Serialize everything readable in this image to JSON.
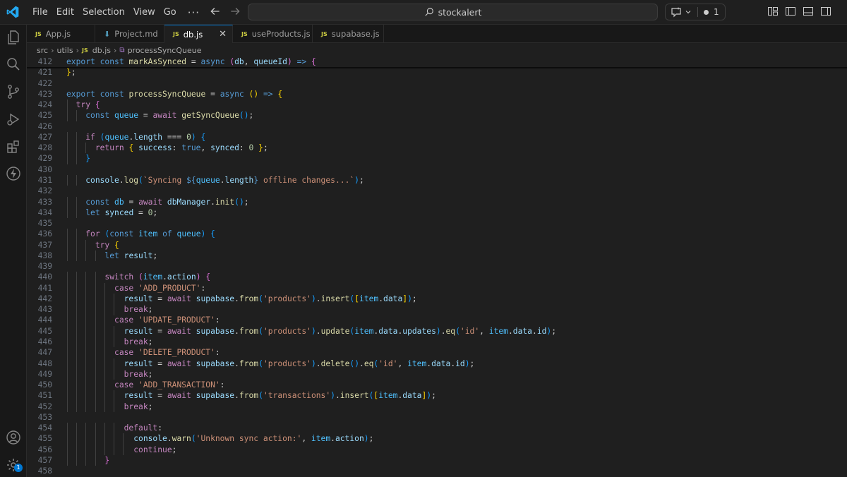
{
  "menu": {
    "file": "File",
    "edit": "Edit",
    "selection": "Selection",
    "view": "View",
    "go": "Go",
    "more": "···"
  },
  "search": {
    "text": "stockalert"
  },
  "copilot": {
    "count": "1"
  },
  "tabs": [
    {
      "icon": "JS",
      "label": "App.js"
    },
    {
      "icon": "md-icon",
      "label": "Project.md"
    },
    {
      "icon": "JS",
      "label": "db.js"
    },
    {
      "icon": "JS",
      "label": "useProducts.js"
    },
    {
      "icon": "JS",
      "label": "supabase.js"
    }
  ],
  "breadcrumb": {
    "p1": "src",
    "p2": "utils",
    "p3": "db.js",
    "p4": "processSyncQueue",
    "js": "JS"
  },
  "activity": {
    "settings_badge": "1"
  },
  "lines": [
    {
      "n": "412",
      "segs": [
        [
          "export",
          "kw"
        ],
        [
          " ",
          ""
        ],
        [
          "const",
          "kw"
        ],
        [
          " ",
          ""
        ],
        [
          "markAsSynced",
          "fn"
        ],
        [
          " = ",
          ""
        ],
        [
          "async",
          "kw"
        ],
        [
          " ",
          ""
        ],
        [
          "(",
          "br2"
        ],
        [
          "db",
          "var"
        ],
        [
          ", ",
          ""
        ],
        [
          "queueId",
          "var"
        ],
        [
          ")",
          "br2"
        ],
        [
          " ",
          ""
        ],
        [
          "=>",
          "kw"
        ],
        [
          " ",
          ""
        ],
        [
          "{",
          "br2"
        ]
      ]
    },
    {
      "n": "421",
      "segs": [
        [
          "}",
          "br1"
        ],
        [
          ";",
          ""
        ]
      ]
    },
    {
      "n": "422",
      "segs": []
    },
    {
      "n": "423",
      "segs": [
        [
          "export",
          "kw"
        ],
        [
          " ",
          ""
        ],
        [
          "const",
          "kw"
        ],
        [
          " ",
          ""
        ],
        [
          "processSyncQueue",
          "fn"
        ],
        [
          " = ",
          ""
        ],
        [
          "async",
          "kw"
        ],
        [
          " ",
          ""
        ],
        [
          "()",
          "br1"
        ],
        [
          " ",
          ""
        ],
        [
          "=>",
          "kw"
        ],
        [
          " ",
          ""
        ],
        [
          "{",
          "br1"
        ]
      ]
    },
    {
      "n": "424",
      "segs": [
        [
          "  ",
          ""
        ],
        [
          "try",
          "ctl"
        ],
        [
          " ",
          ""
        ],
        [
          "{",
          "br2"
        ]
      ]
    },
    {
      "n": "425",
      "segs": [
        [
          "    ",
          ""
        ],
        [
          "const",
          "kw"
        ],
        [
          " ",
          ""
        ],
        [
          "queue",
          "cst"
        ],
        [
          " = ",
          ""
        ],
        [
          "await",
          "ctl"
        ],
        [
          " ",
          ""
        ],
        [
          "getSyncQueue",
          "fn"
        ],
        [
          "()",
          "br3"
        ],
        [
          ";",
          ""
        ]
      ]
    },
    {
      "n": "426",
      "segs": []
    },
    {
      "n": "427",
      "segs": [
        [
          "    ",
          ""
        ],
        [
          "if",
          "ctl"
        ],
        [
          " ",
          ""
        ],
        [
          "(",
          "br3"
        ],
        [
          "queue",
          "cst"
        ],
        [
          ".",
          ""
        ],
        [
          "length",
          "var"
        ],
        [
          " === ",
          ""
        ],
        [
          "0",
          "num"
        ],
        [
          ")",
          "br3"
        ],
        [
          " ",
          ""
        ],
        [
          "{",
          "br3"
        ]
      ]
    },
    {
      "n": "428",
      "segs": [
        [
          "      ",
          ""
        ],
        [
          "return",
          "ctl"
        ],
        [
          " ",
          ""
        ],
        [
          "{",
          "br1"
        ],
        [
          " ",
          ""
        ],
        [
          "success",
          "var"
        ],
        [
          ": ",
          ""
        ],
        [
          "true",
          "bool"
        ],
        [
          ", ",
          ""
        ],
        [
          "synced",
          "var"
        ],
        [
          ": ",
          ""
        ],
        [
          "0",
          "num"
        ],
        [
          " ",
          ""
        ],
        [
          "}",
          "br1"
        ],
        [
          ";",
          ""
        ]
      ]
    },
    {
      "n": "429",
      "segs": [
        [
          "    ",
          ""
        ],
        [
          "}",
          "br3"
        ]
      ]
    },
    {
      "n": "430",
      "segs": []
    },
    {
      "n": "431",
      "segs": [
        [
          "    ",
          ""
        ],
        [
          "console",
          "var"
        ],
        [
          ".",
          ""
        ],
        [
          "log",
          "fn"
        ],
        [
          "(",
          "br3"
        ],
        [
          "`Syncing ",
          "str"
        ],
        [
          "${",
          "kw"
        ],
        [
          "queue",
          "cst"
        ],
        [
          ".",
          ""
        ],
        [
          "length",
          "var"
        ],
        [
          "}",
          "kw"
        ],
        [
          " offline changes...`",
          "str"
        ],
        [
          ")",
          "br3"
        ],
        [
          ";",
          ""
        ]
      ]
    },
    {
      "n": "432",
      "segs": []
    },
    {
      "n": "433",
      "segs": [
        [
          "    ",
          ""
        ],
        [
          "const",
          "kw"
        ],
        [
          " ",
          ""
        ],
        [
          "db",
          "cst"
        ],
        [
          " = ",
          ""
        ],
        [
          "await",
          "ctl"
        ],
        [
          " ",
          ""
        ],
        [
          "dbManager",
          "var"
        ],
        [
          ".",
          ""
        ],
        [
          "init",
          "fn"
        ],
        [
          "()",
          "br3"
        ],
        [
          ";",
          ""
        ]
      ]
    },
    {
      "n": "434",
      "segs": [
        [
          "    ",
          ""
        ],
        [
          "let",
          "kw"
        ],
        [
          " ",
          ""
        ],
        [
          "synced",
          "var"
        ],
        [
          " = ",
          ""
        ],
        [
          "0",
          "num"
        ],
        [
          ";",
          ""
        ]
      ]
    },
    {
      "n": "435",
      "segs": []
    },
    {
      "n": "436",
      "segs": [
        [
          "    ",
          ""
        ],
        [
          "for",
          "ctl"
        ],
        [
          " ",
          ""
        ],
        [
          "(",
          "br3"
        ],
        [
          "const",
          "kw"
        ],
        [
          " ",
          ""
        ],
        [
          "item",
          "cst"
        ],
        [
          " ",
          ""
        ],
        [
          "of",
          "kw"
        ],
        [
          " ",
          ""
        ],
        [
          "queue",
          "cst"
        ],
        [
          ")",
          "br3"
        ],
        [
          " ",
          ""
        ],
        [
          "{",
          "br3"
        ]
      ]
    },
    {
      "n": "437",
      "segs": [
        [
          "      ",
          ""
        ],
        [
          "try",
          "ctl"
        ],
        [
          " ",
          ""
        ],
        [
          "{",
          "br1"
        ]
      ]
    },
    {
      "n": "438",
      "segs": [
        [
          "        ",
          ""
        ],
        [
          "let",
          "kw"
        ],
        [
          " ",
          ""
        ],
        [
          "result",
          "var"
        ],
        [
          ";",
          ""
        ]
      ]
    },
    {
      "n": "439",
      "segs": []
    },
    {
      "n": "440",
      "segs": [
        [
          "        ",
          ""
        ],
        [
          "switch",
          "ctl"
        ],
        [
          " ",
          ""
        ],
        [
          "(",
          "br2"
        ],
        [
          "item",
          "cst"
        ],
        [
          ".",
          ""
        ],
        [
          "action",
          "var"
        ],
        [
          ")",
          "br2"
        ],
        [
          " ",
          ""
        ],
        [
          "{",
          "br2"
        ]
      ]
    },
    {
      "n": "441",
      "segs": [
        [
          "          ",
          ""
        ],
        [
          "case",
          "ctl"
        ],
        [
          " ",
          ""
        ],
        [
          "'ADD_PRODUCT'",
          "str"
        ],
        [
          ":",
          ""
        ]
      ]
    },
    {
      "n": "442",
      "segs": [
        [
          "            ",
          ""
        ],
        [
          "result",
          "var"
        ],
        [
          " = ",
          ""
        ],
        [
          "await",
          "ctl"
        ],
        [
          " ",
          ""
        ],
        [
          "supabase",
          "var"
        ],
        [
          ".",
          ""
        ],
        [
          "from",
          "fn"
        ],
        [
          "(",
          "br3"
        ],
        [
          "'products'",
          "str"
        ],
        [
          ")",
          "br3"
        ],
        [
          ".",
          ""
        ],
        [
          "insert",
          "fn"
        ],
        [
          "(",
          "br3"
        ],
        [
          "[",
          "br1"
        ],
        [
          "item",
          "cst"
        ],
        [
          ".",
          ""
        ],
        [
          "data",
          "var"
        ],
        [
          "]",
          "br1"
        ],
        [
          ")",
          "br3"
        ],
        [
          ";",
          ""
        ]
      ]
    },
    {
      "n": "443",
      "segs": [
        [
          "            ",
          ""
        ],
        [
          "break",
          "ctl"
        ],
        [
          ";",
          ""
        ]
      ]
    },
    {
      "n": "444",
      "segs": [
        [
          "          ",
          ""
        ],
        [
          "case",
          "ctl"
        ],
        [
          " ",
          ""
        ],
        [
          "'UPDATE_PRODUCT'",
          "str"
        ],
        [
          ":",
          ""
        ]
      ]
    },
    {
      "n": "445",
      "segs": [
        [
          "            ",
          ""
        ],
        [
          "result",
          "var"
        ],
        [
          " = ",
          ""
        ],
        [
          "await",
          "ctl"
        ],
        [
          " ",
          ""
        ],
        [
          "supabase",
          "var"
        ],
        [
          ".",
          ""
        ],
        [
          "from",
          "fn"
        ],
        [
          "(",
          "br3"
        ],
        [
          "'products'",
          "str"
        ],
        [
          ")",
          "br3"
        ],
        [
          ".",
          ""
        ],
        [
          "update",
          "fn"
        ],
        [
          "(",
          "br3"
        ],
        [
          "item",
          "cst"
        ],
        [
          ".",
          ""
        ],
        [
          "data",
          "var"
        ],
        [
          ".",
          ""
        ],
        [
          "updates",
          "var"
        ],
        [
          ")",
          "br3"
        ],
        [
          ".",
          ""
        ],
        [
          "eq",
          "fn"
        ],
        [
          "(",
          "br3"
        ],
        [
          "'id'",
          "str"
        ],
        [
          ", ",
          ""
        ],
        [
          "item",
          "cst"
        ],
        [
          ".",
          ""
        ],
        [
          "data",
          "var"
        ],
        [
          ".",
          ""
        ],
        [
          "id",
          "var"
        ],
        [
          ")",
          "br3"
        ],
        [
          ";",
          ""
        ]
      ]
    },
    {
      "n": "446",
      "segs": [
        [
          "            ",
          ""
        ],
        [
          "break",
          "ctl"
        ],
        [
          ";",
          ""
        ]
      ]
    },
    {
      "n": "447",
      "segs": [
        [
          "          ",
          ""
        ],
        [
          "case",
          "ctl"
        ],
        [
          " ",
          ""
        ],
        [
          "'DELETE_PRODUCT'",
          "str"
        ],
        [
          ":",
          ""
        ]
      ]
    },
    {
      "n": "448",
      "segs": [
        [
          "            ",
          ""
        ],
        [
          "result",
          "var"
        ],
        [
          " = ",
          ""
        ],
        [
          "await",
          "ctl"
        ],
        [
          " ",
          ""
        ],
        [
          "supabase",
          "var"
        ],
        [
          ".",
          ""
        ],
        [
          "from",
          "fn"
        ],
        [
          "(",
          "br3"
        ],
        [
          "'products'",
          "str"
        ],
        [
          ")",
          "br3"
        ],
        [
          ".",
          ""
        ],
        [
          "delete",
          "fn"
        ],
        [
          "()",
          "br3"
        ],
        [
          ".",
          ""
        ],
        [
          "eq",
          "fn"
        ],
        [
          "(",
          "br3"
        ],
        [
          "'id'",
          "str"
        ],
        [
          ", ",
          ""
        ],
        [
          "item",
          "cst"
        ],
        [
          ".",
          ""
        ],
        [
          "data",
          "var"
        ],
        [
          ".",
          ""
        ],
        [
          "id",
          "var"
        ],
        [
          ")",
          "br3"
        ],
        [
          ";",
          ""
        ]
      ]
    },
    {
      "n": "449",
      "segs": [
        [
          "            ",
          ""
        ],
        [
          "break",
          "ctl"
        ],
        [
          ";",
          ""
        ]
      ]
    },
    {
      "n": "450",
      "segs": [
        [
          "          ",
          ""
        ],
        [
          "case",
          "ctl"
        ],
        [
          " ",
          ""
        ],
        [
          "'ADD_TRANSACTION'",
          "str"
        ],
        [
          ":",
          ""
        ]
      ]
    },
    {
      "n": "451",
      "segs": [
        [
          "            ",
          ""
        ],
        [
          "result",
          "var"
        ],
        [
          " = ",
          ""
        ],
        [
          "await",
          "ctl"
        ],
        [
          " ",
          ""
        ],
        [
          "supabase",
          "var"
        ],
        [
          ".",
          ""
        ],
        [
          "from",
          "fn"
        ],
        [
          "(",
          "br3"
        ],
        [
          "'transactions'",
          "str"
        ],
        [
          ")",
          "br3"
        ],
        [
          ".",
          ""
        ],
        [
          "insert",
          "fn"
        ],
        [
          "(",
          "br3"
        ],
        [
          "[",
          "br1"
        ],
        [
          "item",
          "cst"
        ],
        [
          ".",
          ""
        ],
        [
          "data",
          "var"
        ],
        [
          "]",
          "br1"
        ],
        [
          ")",
          "br3"
        ],
        [
          ";",
          ""
        ]
      ]
    },
    {
      "n": "452",
      "segs": [
        [
          "            ",
          ""
        ],
        [
          "break",
          "ctl"
        ],
        [
          ";",
          ""
        ]
      ]
    },
    {
      "n": "453",
      "segs": []
    },
    {
      "n": "454",
      "segs": [
        [
          "            ",
          ""
        ],
        [
          "default",
          "ctl"
        ],
        [
          ":",
          ""
        ]
      ]
    },
    {
      "n": "455",
      "segs": [
        [
          "              ",
          ""
        ],
        [
          "console",
          "var"
        ],
        [
          ".",
          ""
        ],
        [
          "warn",
          "fn"
        ],
        [
          "(",
          "br3"
        ],
        [
          "'Unknown sync action:'",
          "str"
        ],
        [
          ", ",
          ""
        ],
        [
          "item",
          "cst"
        ],
        [
          ".",
          ""
        ],
        [
          "action",
          "var"
        ],
        [
          ")",
          "br3"
        ],
        [
          ";",
          ""
        ]
      ]
    },
    {
      "n": "456",
      "segs": [
        [
          "              ",
          ""
        ],
        [
          "continue",
          "ctl"
        ],
        [
          ";",
          ""
        ]
      ]
    },
    {
      "n": "457",
      "segs": [
        [
          "        ",
          ""
        ],
        [
          "}",
          "br2"
        ]
      ]
    },
    {
      "n": "458",
      "segs": []
    }
  ]
}
